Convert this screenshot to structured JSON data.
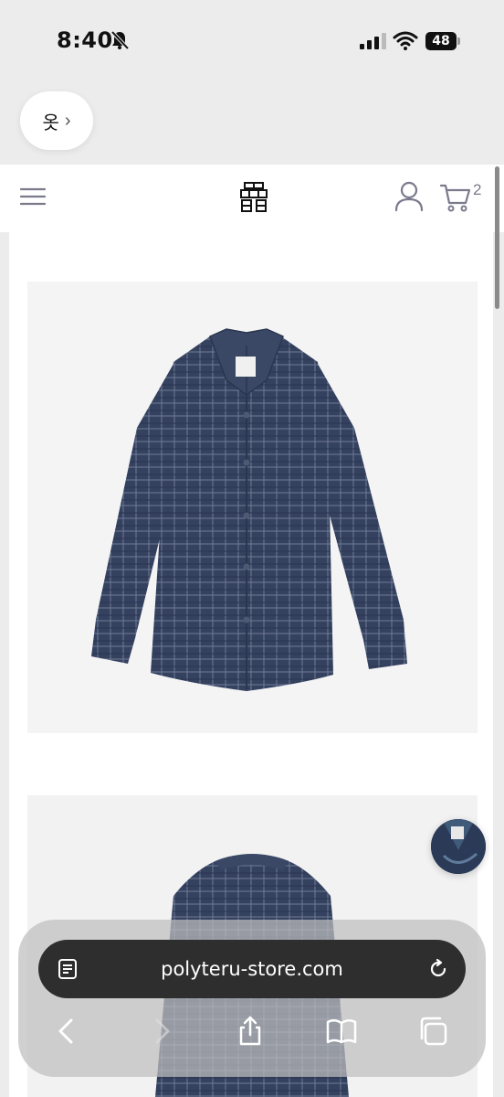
{
  "status_bar": {
    "time": "8:40",
    "battery": "48"
  },
  "app_pill": {
    "label": "옷"
  },
  "header": {
    "cart_count": "2"
  },
  "browser": {
    "url": "polyteru-store.com"
  },
  "colors": {
    "accent": "#7a7a8c",
    "shirt": "#34415f"
  },
  "icons": [
    "bell-slash-icon",
    "signal-icon",
    "wifi-icon",
    "battery-icon",
    "menu-icon",
    "user-icon",
    "cart-icon",
    "reader-icon",
    "reload-icon",
    "back-icon",
    "forward-icon",
    "share-icon",
    "bookmarks-icon",
    "tabs-icon"
  ]
}
